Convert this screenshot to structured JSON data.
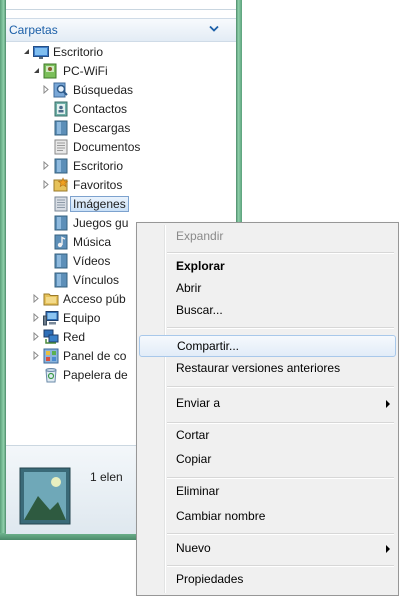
{
  "nav_pane": {
    "header": "Carpetas",
    "tree": [
      {
        "label": "Escritorio",
        "icon": "desktop-icon",
        "expander": "expanded"
      },
      {
        "label": "PC-WiFi",
        "icon": "user-folder-icon",
        "expander": "expanded"
      },
      {
        "label": "Búsquedas",
        "icon": "search-folder-icon",
        "expander": "collapsed"
      },
      {
        "label": "Contactos",
        "icon": "contacts-folder-icon",
        "expander": "none"
      },
      {
        "label": "Descargas",
        "icon": "downloads-folder-icon",
        "expander": "none"
      },
      {
        "label": "Documentos",
        "icon": "documents-folder-icon",
        "expander": "none"
      },
      {
        "label": "Escritorio",
        "icon": "desktop-folder-icon",
        "expander": "collapsed"
      },
      {
        "label": "Favoritos",
        "icon": "favorites-folder-icon",
        "expander": "collapsed"
      },
      {
        "label": "Imágenes",
        "icon": "pictures-folder-icon",
        "expander": "none",
        "selected": true
      },
      {
        "label": "Juegos gu",
        "icon": "saved-games-folder-icon",
        "expander": "none"
      },
      {
        "label": "Música",
        "icon": "music-folder-icon",
        "expander": "none"
      },
      {
        "label": "Vídeos",
        "icon": "videos-folder-icon",
        "expander": "none"
      },
      {
        "label": "Vínculos",
        "icon": "links-folder-icon",
        "expander": "none"
      },
      {
        "label": "Acceso púb",
        "icon": "public-folder-icon",
        "expander": "collapsed"
      },
      {
        "label": "Equipo",
        "icon": "computer-icon",
        "expander": "collapsed"
      },
      {
        "label": "Red",
        "icon": "network-icon",
        "expander": "collapsed"
      },
      {
        "label": "Panel de co",
        "icon": "control-panel-icon",
        "expander": "collapsed"
      },
      {
        "label": "Papelera de",
        "icon": "recycle-bin-icon",
        "expander": "none"
      }
    ]
  },
  "details_pane": {
    "count_text": "1 elen"
  },
  "context_menu": {
    "items": [
      {
        "label": "Expandir",
        "state": "disabled"
      },
      {
        "label": "Explorar",
        "state": "bold"
      },
      {
        "label": "Abrir"
      },
      {
        "label": "Buscar..."
      },
      {
        "label": "Compartir...",
        "state": "highlighted"
      },
      {
        "label": "Restaurar versiones anteriores"
      },
      {
        "label": "Enviar a",
        "submenu": true
      },
      {
        "label": "Cortar"
      },
      {
        "label": "Copiar"
      },
      {
        "label": "Eliminar"
      },
      {
        "label": "Cambiar nombre"
      },
      {
        "label": "Nuevo",
        "submenu": true
      },
      {
        "label": "Propiedades"
      }
    ]
  },
  "colors": {
    "frame": "#6fb48e",
    "header_text": "#1b5fa8",
    "selection_border": "#7da2ce",
    "menu_highlight_border": "#a8c8ea",
    "menu_background": "#f0f0f0"
  }
}
